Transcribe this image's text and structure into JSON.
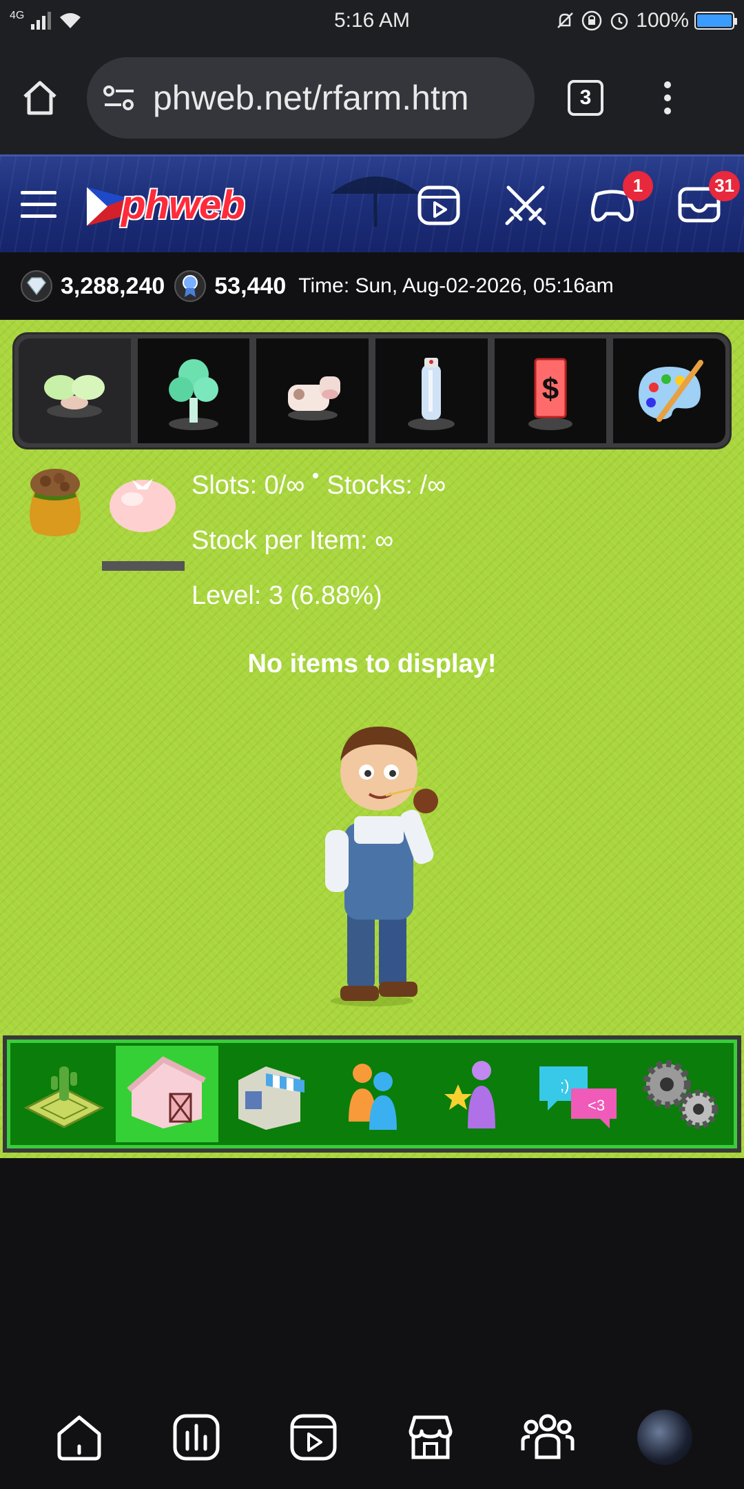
{
  "status_bar": {
    "network": "4G",
    "time": "5:16 AM",
    "battery": "100%"
  },
  "browser": {
    "url": "phweb.net/rfarm.htm",
    "tab_count": "3"
  },
  "site_header": {
    "logo_text": "phweb",
    "game_badge": "1",
    "inbox_badge": "31"
  },
  "info_bar": {
    "diamonds": "3,288,240",
    "points": "53,440",
    "time": "Time: Sun, Aug-02-2026, 05:16am"
  },
  "category_tabs": [
    {
      "name": "seedling"
    },
    {
      "name": "tree"
    },
    {
      "name": "cow"
    },
    {
      "name": "spray-can"
    },
    {
      "name": "dollar-card"
    },
    {
      "name": "paint-palette"
    }
  ],
  "seed_panel": {
    "slots": "Slots: 0/∞",
    "stocks": "Stocks: /∞",
    "stock_per_item": "Stock per Item: ∞",
    "level": "Level: 3 (6.88%)"
  },
  "empty_message": "No items to display!",
  "game_nav": [
    {
      "name": "farm-plot"
    },
    {
      "name": "barn",
      "active": true
    },
    {
      "name": "shop"
    },
    {
      "name": "friends"
    },
    {
      "name": "star-user"
    },
    {
      "name": "chat"
    },
    {
      "name": "settings"
    }
  ]
}
